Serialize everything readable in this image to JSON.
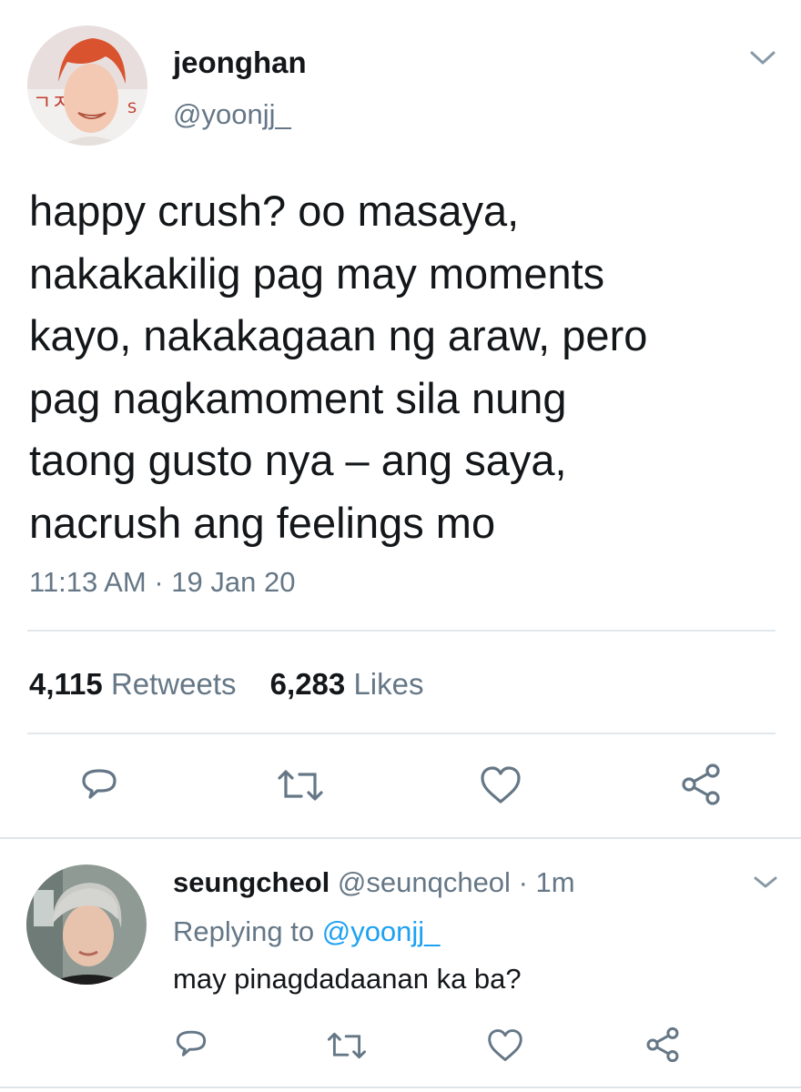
{
  "tweet": {
    "author_name": "jeonghan",
    "author_handle": "@yoonjj_",
    "text_lines": [
      "happy crush? oo masaya,",
      "nakakakilig pag may moments",
      "kayo, nakakagaan ng araw, pero",
      "pag nagkamoment sila nung",
      "taong gusto nya – ang saya,",
      "nacrush ang feelings mo"
    ],
    "time": "11:13 AM",
    "separator": "·",
    "date": "19 Jan 20",
    "retweets_count": "4,115",
    "retweets_label": "Retweets",
    "likes_count": "6,283",
    "likes_label": "Likes"
  },
  "reply": {
    "author_name": "seungcheol",
    "author_handle": "@seunqcheol",
    "separator": "·",
    "time_ago": "1m",
    "replying_to_label": "Replying to",
    "replying_to_handle": "@yoonjj_",
    "text": "may pinagdadaanan ka ba?"
  },
  "icons": {
    "action_color": "#657786",
    "chevron_color": "#8899a6",
    "names": [
      "chevron-down-icon",
      "reply-icon",
      "retweet-icon",
      "like-icon",
      "share-icon"
    ]
  },
  "colors": {
    "text": "#14171a",
    "secondary": "#657786",
    "link": "#1da1f2",
    "divider": "#e1e8ed"
  }
}
